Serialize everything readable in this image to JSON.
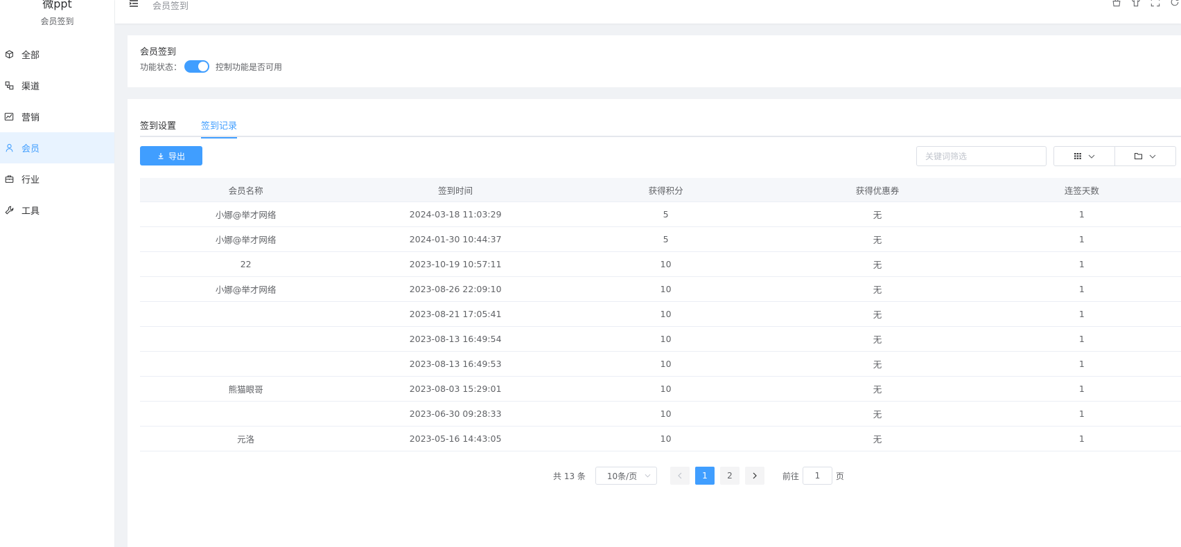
{
  "brand": {
    "name": "微ppt",
    "subtitle": "会员签到"
  },
  "sidebar": {
    "items": [
      {
        "label": "全部",
        "icon": "cube-icon"
      },
      {
        "label": "渠道",
        "icon": "channel-icon"
      },
      {
        "label": "营销",
        "icon": "chart-icon"
      },
      {
        "label": "会员",
        "icon": "user-icon",
        "active": true
      },
      {
        "label": "行业",
        "icon": "briefcase-icon"
      },
      {
        "label": "工具",
        "icon": "wrench-icon"
      }
    ]
  },
  "header": {
    "breadcrumb": "会员签到"
  },
  "status_card": {
    "title": "会员签到",
    "label": "功能状态：",
    "switch_on": true,
    "hint": "控制功能是否可用"
  },
  "tabs": [
    {
      "label": "签到设置",
      "active": false
    },
    {
      "label": "签到记录",
      "active": true
    }
  ],
  "toolbar": {
    "export_label": "导出",
    "search_placeholder": "关键词筛选"
  },
  "table": {
    "headers": [
      "会员名称",
      "签到时间",
      "获得积分",
      "获得优惠券",
      "连签天数"
    ],
    "rows": [
      [
        "小娜@举才网络",
        "2024-03-18 11:03:29",
        "5",
        "无",
        "1"
      ],
      [
        "小娜@举才网络",
        "2024-01-30 10:44:37",
        "5",
        "无",
        "1"
      ],
      [
        "22",
        "2023-10-19 10:57:11",
        "10",
        "无",
        "1"
      ],
      [
        "小娜@举才网络",
        "2023-08-26 22:09:10",
        "10",
        "无",
        "1"
      ],
      [
        "",
        "2023-08-21 17:05:41",
        "10",
        "无",
        "1"
      ],
      [
        "",
        "2023-08-13 16:49:54",
        "10",
        "无",
        "1"
      ],
      [
        "",
        "2023-08-13 16:49:53",
        "10",
        "无",
        "1"
      ],
      [
        "熊猫眼哥",
        "2023-08-03 15:29:01",
        "10",
        "无",
        "1"
      ],
      [
        "",
        "2023-06-30 09:28:33",
        "10",
        "无",
        "1"
      ],
      [
        "元洛",
        "2023-05-16 14:43:05",
        "10",
        "无",
        "1"
      ]
    ]
  },
  "pagination": {
    "total_label": "共 13 条",
    "page_size_label": "10条/页",
    "pages": [
      "1",
      "2"
    ],
    "current_page": "1",
    "goto_prefix": "前往",
    "goto_value": "1",
    "goto_suffix": "页"
  },
  "colors": {
    "accent": "#409eff",
    "active_bg": "#e8f3ff"
  }
}
